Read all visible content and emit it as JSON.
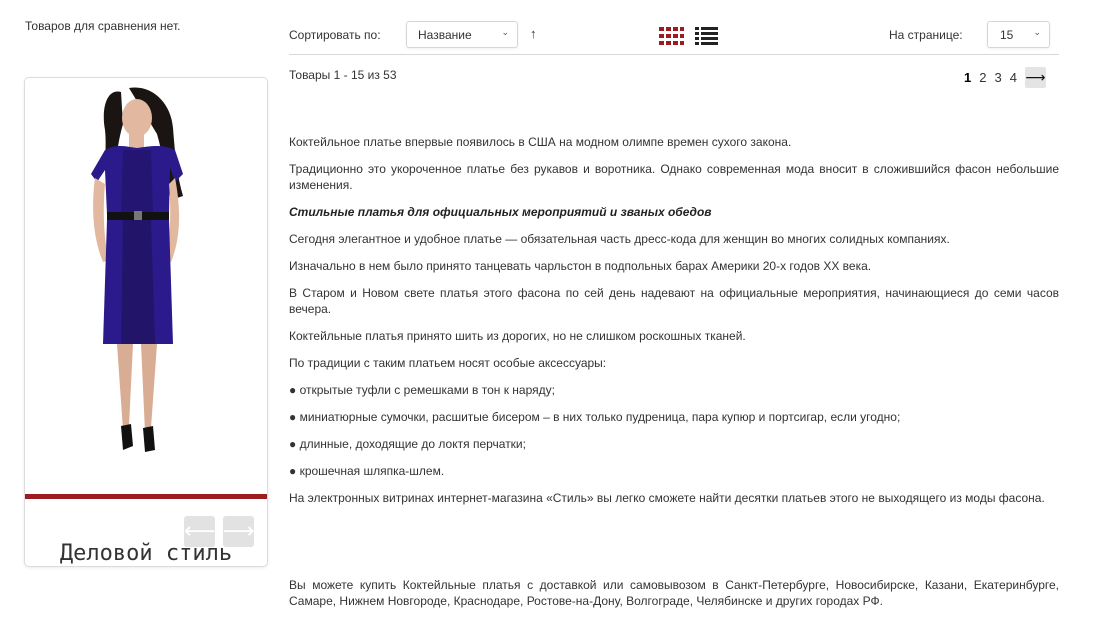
{
  "compare": {
    "note": "Товаров для сравнения нет."
  },
  "banner": {
    "caption": "Деловой стиль",
    "prev_arrow": "⟵",
    "next_arrow": "⟶",
    "colors": {
      "dress": "#2a1a8c",
      "stripe": "#9b1d20"
    }
  },
  "toolbar": {
    "sort_label": "Сортировать по:",
    "sort_value": "Название",
    "sort_direction": "↑",
    "view_grid_icon": "grid-icon",
    "view_list_icon": "list-icon",
    "perpage_label": "На странице:",
    "perpage_value": "15",
    "accent_color": "#9b1d20"
  },
  "listing": {
    "count_text": "Товары 1 - 15 из 53",
    "pages": [
      "1",
      "2",
      "3",
      "4"
    ],
    "current_page": "1",
    "next_arrow": "⟶"
  },
  "article": {
    "p1": "Коктейльное платье впервые появилось в США на модном олимпе времен сухого закона.",
    "p2": "Традиционно это укороченное платье без рукавов и воротника. Однако современная мода вносит в сложившийся фасон небольшие изменения.",
    "heading": "Стильные платья для официальных мероприятий и званых обедов",
    "p3": "Сегодня элегантное и удобное платье — обязательная часть дресс-кода для женщин во многих солидных компаниях.",
    "p4": "Изначально в нем было принято танцевать чарльстон в подпольных барах Америки 20-х годов XX века.",
    "p5": "В Старом и Новом свете платья этого фасона по сей день надевают на официальные мероприятия, начинающиеся до семи часов вечера.",
    "p6": "Коктейльные платья принято шить из дорогих, но не слишком роскошных тканей.",
    "p7": "По традиции с таким платьем носят особые аксессуары:",
    "li1": "● открытые туфли с ремешками в тон к наряду;",
    "li2": "● миниатюрные сумочки, расшитые бисером – в них только пудреница, пара купюр и портсигар, если угодно;",
    "li3": "● длинные, доходящие до локтя перчатки;",
    "li4": "● крошечная шляпка-шлем.",
    "p8": "На электронных витринах интернет-магазина «Стиль» вы легко сможете найти десятки платьев этого не выходящего из моды фасона.",
    "p9": "Вы можете купить Коктейльные платья с доставкой или самовывозом в Санкт-Петербурге, Новосибирске, Казани, Екатеринбурге, Самаре, Нижнем Новгороде, Краснодаре, Ростове-на-Дону, Волгограде, Челябинске и других городах РФ."
  }
}
